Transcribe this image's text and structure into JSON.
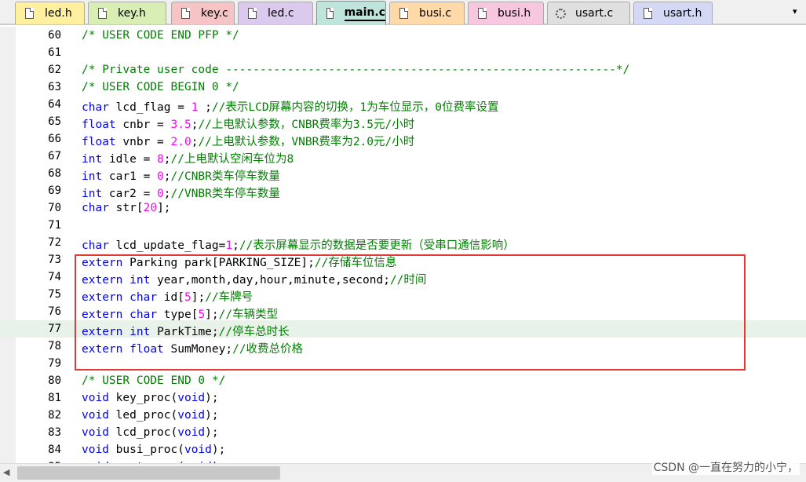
{
  "tabs": [
    {
      "label": "led.h",
      "color": "#fff0a0",
      "icon": "file-icon"
    },
    {
      "label": "key.h",
      "color": "#d8eeb4",
      "icon": "file-icon"
    },
    {
      "label": "key.c",
      "color": "#f6c4c4",
      "icon": "file-icon"
    },
    {
      "label": "led.c",
      "color": "#dccaee",
      "icon": "file-icon"
    },
    {
      "label": "main.c",
      "color": "#bfe4dc",
      "icon": "file-icon",
      "active": true
    },
    {
      "label": "busi.c",
      "color": "#ffd9a8",
      "icon": "file-icon"
    },
    {
      "label": "busi.h",
      "color": "#f7c6df",
      "icon": "file-icon"
    },
    {
      "label": "usart.c",
      "color": "#dfdfdf",
      "icon": "gear-file-icon"
    },
    {
      "label": "usart.h",
      "color": "#d4d8f4",
      "icon": "file-icon"
    }
  ],
  "tab_dropdown_icon": "▾",
  "editor": {
    "current_line": "77",
    "highlight_color": "#e53935",
    "lines": [
      {
        "num": "60",
        "code": "/* USER CODE END PFP */"
      },
      {
        "num": "61",
        "code": ""
      },
      {
        "num": "62",
        "code": "/* Private user code ---------------------------------------------------------*/"
      },
      {
        "num": "63",
        "code": "/* USER CODE BEGIN 0 */"
      },
      {
        "num": "64",
        "code": "char lcd_flag = 1 ;//表示LCD屏幕内容的切换，1为车位显示，0位费率设置"
      },
      {
        "num": "65",
        "code": "float cnbr = 3.5;//上电默认参数，CNBR费率为3.5元/小时"
      },
      {
        "num": "66",
        "code": "float vnbr = 2.0;//上电默认参数，VNBR费率为2.0元/小时"
      },
      {
        "num": "67",
        "code": "int idle = 8;//上电默认空闲车位为8"
      },
      {
        "num": "68",
        "code": "int car1 = 0;//CNBR类车停车数量"
      },
      {
        "num": "69",
        "code": "int car2 = 0;//VNBR类车停车数量"
      },
      {
        "num": "70",
        "code": "char str[20];"
      },
      {
        "num": "71",
        "code": ""
      },
      {
        "num": "72",
        "code": "char lcd_update_flag=1;//表示屏幕显示的数据是否要更新（受串口通信影响）"
      },
      {
        "num": "73",
        "code": "extern Parking park[PARKING_SIZE];//存储车位信息"
      },
      {
        "num": "74",
        "code": "extern int year,month,day,hour,minute,second;//时间"
      },
      {
        "num": "75",
        "code": "extern char id[5];//车牌号"
      },
      {
        "num": "76",
        "code": "extern char type[5];//车辆类型"
      },
      {
        "num": "77",
        "code": "extern int ParkTime;//停车总时长"
      },
      {
        "num": "78",
        "code": "extern float SumMoney;//收费总价格"
      },
      {
        "num": "79",
        "code": ""
      },
      {
        "num": "80",
        "code": "/* USER CODE END 0 */"
      },
      {
        "num": "81",
        "code": "void key_proc(void);"
      },
      {
        "num": "82",
        "code": "void led_proc(void);"
      },
      {
        "num": "83",
        "code": "void lcd_proc(void);"
      },
      {
        "num": "84",
        "code": "void busi_proc(void);"
      },
      {
        "num": "85",
        "code": "void uart_proc(void);"
      }
    ]
  },
  "scrollbar": {
    "left_arrow": "◀"
  },
  "watermark": "CSDN @一直在努力的小宁，"
}
